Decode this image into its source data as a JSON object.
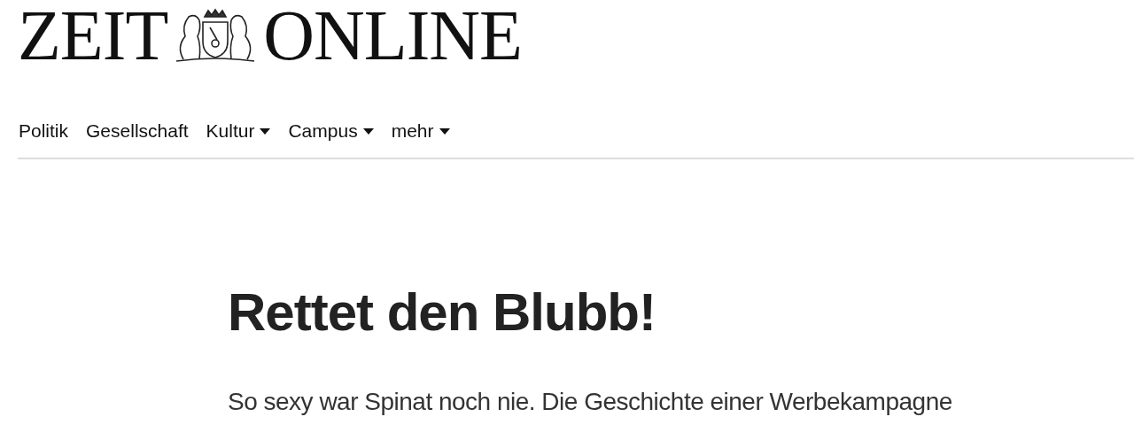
{
  "logo": {
    "left": "ZEIT",
    "right": "ONLINE"
  },
  "nav": [
    {
      "label": "Politik",
      "has_menu": false
    },
    {
      "label": "Gesellschaft",
      "has_menu": false
    },
    {
      "label": "Kultur",
      "has_menu": true
    },
    {
      "label": "Campus",
      "has_menu": true
    },
    {
      "label": "mehr",
      "has_menu": true
    }
  ],
  "article": {
    "headline": "Rettet den Blubb!",
    "summary": "So sexy war Spinat noch nie. Die Geschichte einer Werbekampagne"
  }
}
